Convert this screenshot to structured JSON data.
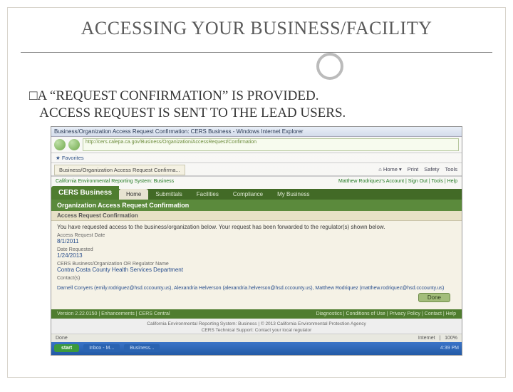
{
  "slide": {
    "title": "ACCESSING YOUR BUSINESS/FACILITY",
    "bullet_line1": "A “REQUEST CONFIRMATION” IS PROVIDED.",
    "bullet_line2": "ACCESS REQUEST IS SENT TO THE LEAD USERS."
  },
  "browser": {
    "window_title": "Business/Organization Access Request Confirmation: CERS Business - Windows Internet Explorer",
    "address": "http://cers.calepa.ca.gov/Business/Organization/AccessRequest/Confirmation",
    "fav_label": "Favorites",
    "tab_label": "Business/Organization Access Request Confirma...",
    "tool_home": "Home",
    "tool_print": "Print",
    "tool_safety": "Safety",
    "tool_tools": "Tools",
    "status_left": "Done",
    "status_right": "Internet",
    "zoom": "100%"
  },
  "cers": {
    "header_left": "California Environmental Reporting System: Business",
    "header_right": "Matthew Rodriquez's Account  |  Sign Out  |  Tools  |  Help",
    "brand": "CERS Business",
    "tabs": [
      "Home",
      "Submittals",
      "Facilities",
      "Compliance",
      "My Business"
    ],
    "panel_title": "Organization Access Request Confirmation",
    "panel_sub": "Access Request Confirmation",
    "intro": "You have requested access to the business/organization below. Your request has been forwarded to the regulator(s) shown below.",
    "f1_label": "Access Request Date",
    "f1_value": "8/1/2011",
    "f2_label": "Date Requested",
    "f2_value": "1/24/2013",
    "f3_label": "CERS Business/Organization OR Regulator Name",
    "f3_value": "Contra Costa County Health Services Department",
    "contacts_label": "Contact(s)",
    "contacts_text": "Darnell Conyers (emily.rodriguez@hsd.cccounty.us), Alexandria Helverson (alexandria.helverson@hsd.cccounty.us), Matthew Rodriquez (matthew.rodriquez@hsd.cccounty.us)",
    "done": "Done",
    "footer_left": "Version 2.22.0150 | Enhancements | CERS Central",
    "footer_right": "Diagnostics | Conditions of Use | Privacy Policy | Contact | Help",
    "footer_grey1": "California Environmental Reporting System: Business | © 2013 California Environmental Protection Agency",
    "footer_grey2": "CERS Technical Support: Contact your local regulator"
  },
  "taskbar": {
    "start": "start",
    "item1": "Inbox - M...",
    "item2": "Business...",
    "time": "4:39 PM"
  }
}
